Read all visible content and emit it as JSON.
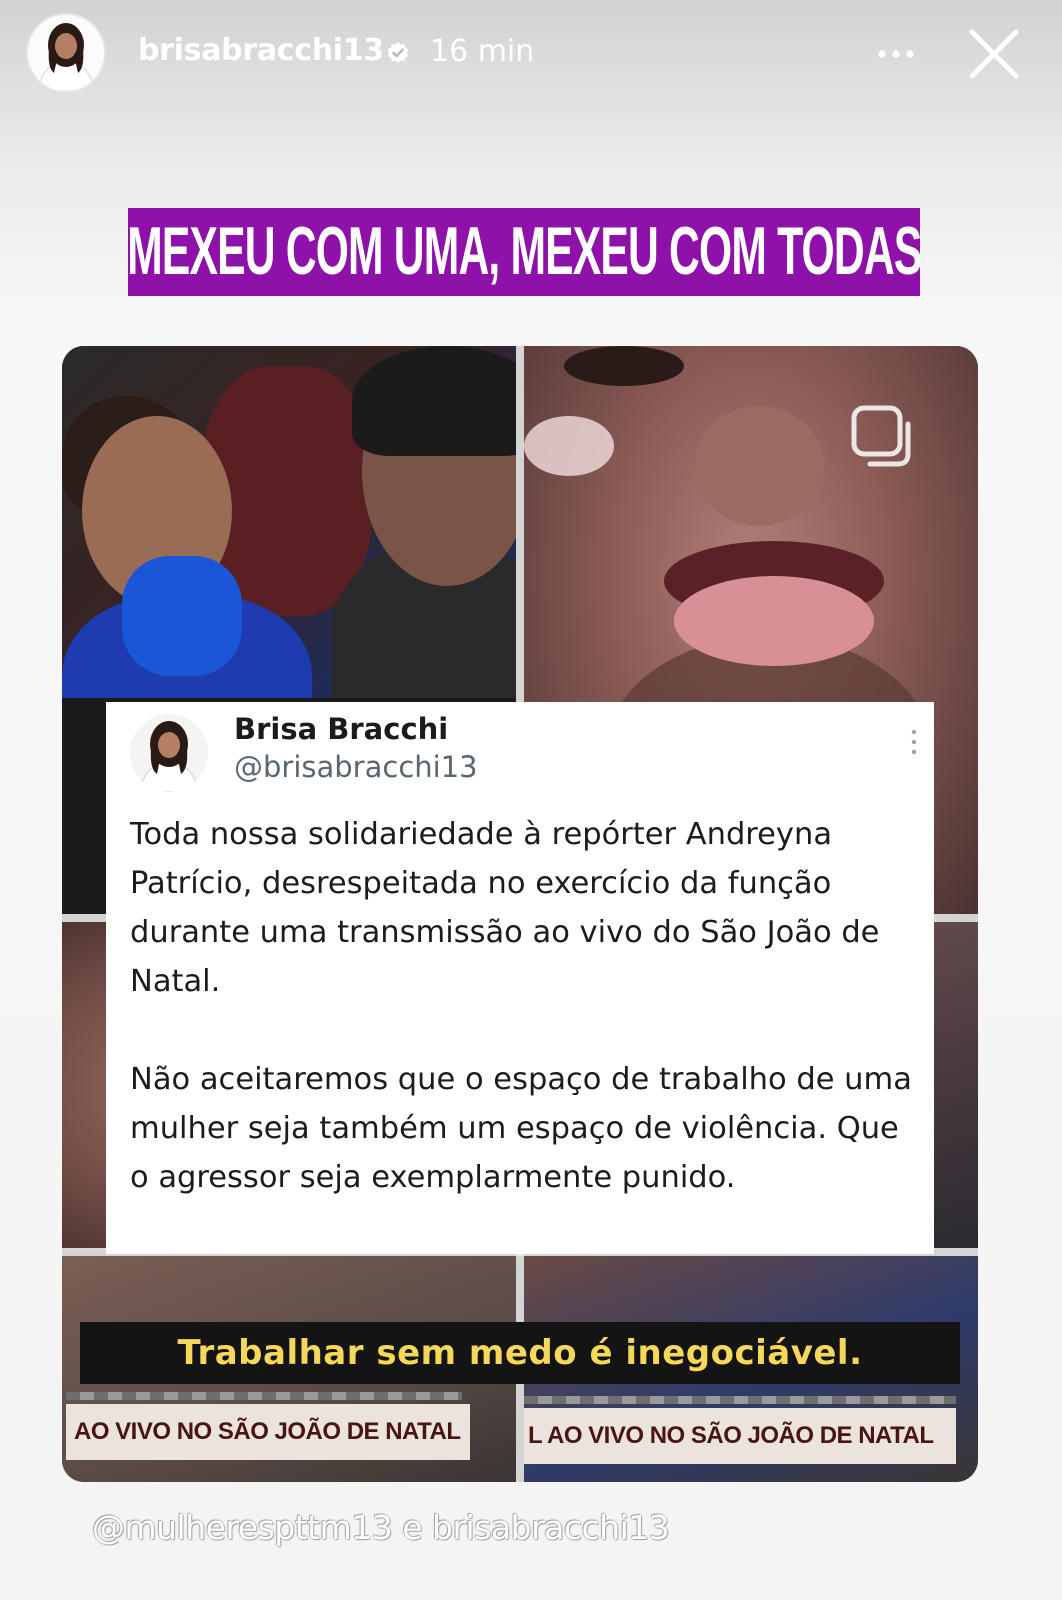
{
  "story": {
    "username": "brisabracchi13",
    "verified": true,
    "time_ago": "16 min",
    "icons": {
      "more": "more-horizontal-icon",
      "close": "close-icon",
      "verified": "verified-badge-icon"
    }
  },
  "banner": {
    "text": "MEXEU COM UMA, MEXEU COM TODAS",
    "background_color": "#8e11a9",
    "text_color": "#ffffff"
  },
  "collage": {
    "icon": "multiple-media-icon"
  },
  "tweet": {
    "name": "Brisa Bracchi",
    "handle": "@brisabracchi13",
    "paragraphs": [
      "Toda nossa solidariedade à repórter Andreyna Patrício, desrespeitada no exercício da função durante uma transmissão ao vivo do São João de Natal.",
      "Não aceitaremos que o espaço de trabalho de uma mulher seja também um espaço de violência. Que o agressor seja exemplarmente punido."
    ]
  },
  "caption": {
    "text": "Trabalhar sem medo é inegociável.",
    "text_color": "#f5d75a"
  },
  "lower_thirds": {
    "left": "AO VIVO NO SÃO JOÃO DE NATAL",
    "right": "L AO VIVO NO SÃO JOÃO DE NATAL"
  },
  "mentions": {
    "text": "@mulherespttm13 e brisabracchi13"
  }
}
